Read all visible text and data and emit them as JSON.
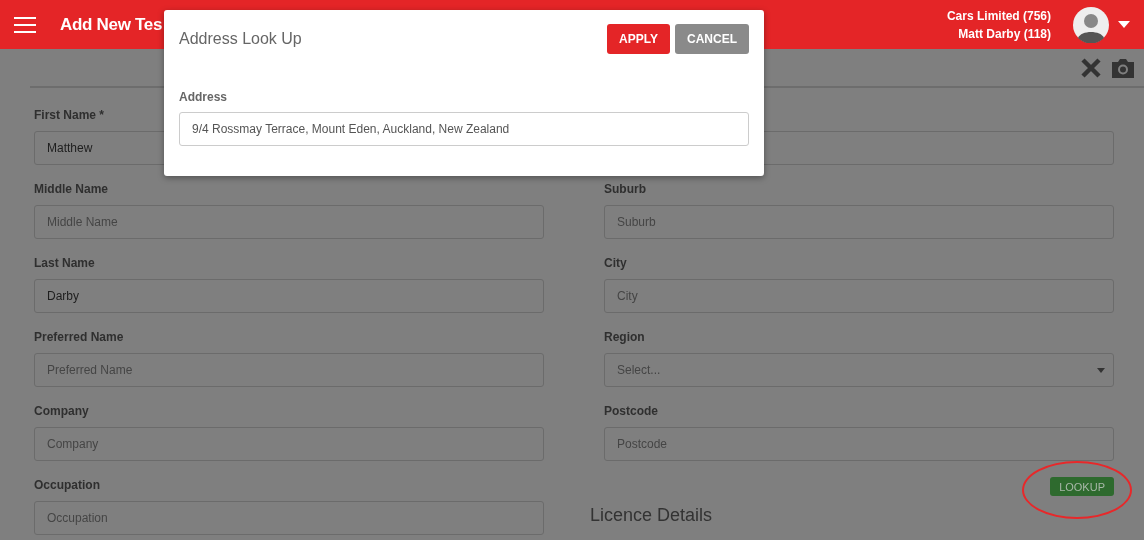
{
  "header": {
    "title": "Add New Tes",
    "account": "Cars Limited (756)",
    "user": "Matt Darby (118)"
  },
  "left_fields": [
    {
      "kind": "text",
      "label": "First Name *",
      "value": "Matthew"
    },
    {
      "kind": "text",
      "label": "Middle Name",
      "placeholder": "Middle Name"
    },
    {
      "kind": "text",
      "label": "Last Name",
      "value": "Darby"
    },
    {
      "kind": "text",
      "label": "Preferred Name",
      "placeholder": "Preferred Name"
    },
    {
      "kind": "text",
      "label": "Company",
      "placeholder": "Company"
    },
    {
      "kind": "text",
      "label": "Occupation",
      "placeholder": "Occupation"
    }
  ],
  "right_fields": [
    {
      "kind": "text"
    },
    {
      "kind": "text",
      "label": "Suburb",
      "placeholder": "Suburb"
    },
    {
      "kind": "text",
      "label": "City",
      "placeholder": "City"
    },
    {
      "kind": "select",
      "label": "Region",
      "placeholder": "Select..."
    },
    {
      "kind": "text",
      "label": "Postcode",
      "placeholder": "Postcode"
    }
  ],
  "lookup_button": "LOOKUP",
  "section_heading": "Licence Details",
  "dialog": {
    "title": "Address Look Up",
    "buttons": [
      {
        "label": "APPLY",
        "kind": "primary"
      },
      {
        "label": "CANCEL",
        "kind": "secondary"
      }
    ],
    "field": {
      "label": "Address",
      "value": "9/4 Rossmay Terrace, Mount Eden, Auckland, New Zealand"
    }
  }
}
